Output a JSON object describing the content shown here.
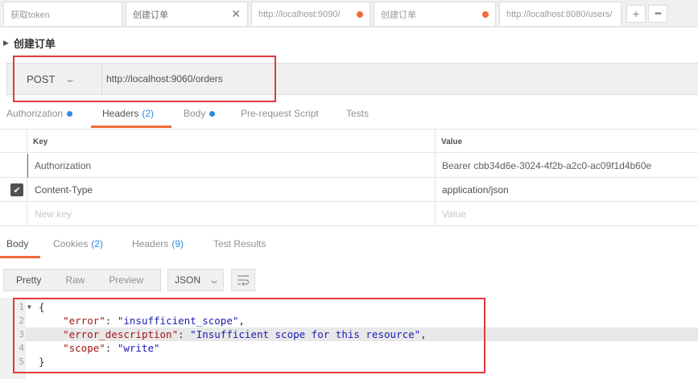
{
  "tabs": [
    {
      "label": "获取token",
      "has_close": false,
      "has_dot": false
    },
    {
      "label": "创建订单",
      "has_close": true,
      "has_dot": false
    },
    {
      "label": "http://localhost:9090/",
      "has_close": false,
      "has_dot": true
    },
    {
      "label": "创建订单",
      "has_close": false,
      "has_dot": true
    },
    {
      "label": "http://localhost:8080/users/",
      "has_close": false,
      "has_dot": false
    }
  ],
  "tab_actions": {
    "new": "+",
    "more": "•••"
  },
  "request": {
    "name": "创建订单",
    "method": "POST",
    "url": "http://localhost:9060/orders"
  },
  "request_tabs": {
    "authorization": "Authorization",
    "headers": "Headers",
    "headers_count": "(2)",
    "body": "Body",
    "prerequest": "Pre-request Script",
    "tests": "Tests"
  },
  "headers_table": {
    "key_header": "Key",
    "value_header": "Value",
    "rows": [
      {
        "key": "Authorization",
        "value": "Bearer cbb34d6e-3024-4f2b-a2c0-ac09f1d4b60e",
        "checked": false
      },
      {
        "key": "Content-Type",
        "value": "application/json",
        "checked": true
      }
    ],
    "new_key_placeholder": "New key",
    "new_value_placeholder": "Value"
  },
  "response_tabs": {
    "body": "Body",
    "cookies": "Cookies",
    "cookies_count": "(2)",
    "headers": "Headers",
    "headers_count": "(9)",
    "test_results": "Test Results"
  },
  "response_toolbar": {
    "pretty": "Pretty",
    "raw": "Raw",
    "preview": "Preview",
    "format": "JSON"
  },
  "response_body": {
    "line_numbers": [
      "1",
      "2",
      "3",
      "4",
      "5"
    ],
    "open": "{",
    "close": "}",
    "fields": [
      {
        "key": "\"error\"",
        "value": "\"insufficient_scope\"",
        "trail": ","
      },
      {
        "key": "\"error_description\"",
        "value": "\"Insufficient scope for this resource\"",
        "trail": ","
      },
      {
        "key": "\"scope\"",
        "value": "\"write\"",
        "trail": ""
      }
    ]
  },
  "colors": {
    "accent": "#f26b3a",
    "blue": "#2f89e5",
    "highlight_box": "#e0393e"
  }
}
